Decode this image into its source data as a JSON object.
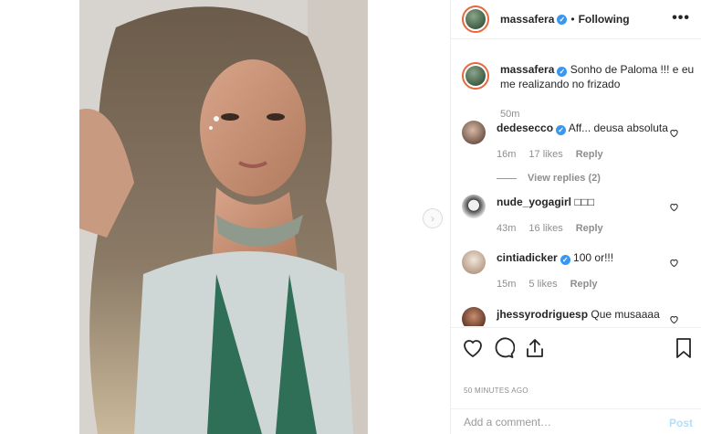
{
  "post": {
    "username": "massafera",
    "follow_status": "Following",
    "dot": "•",
    "verified_mark": "✓",
    "next_arrow": "›",
    "caption": {
      "username": "massafera",
      "text": "Sonho de Paloma !!! e eu me realizando no frizado",
      "time": "50m"
    }
  },
  "comments": [
    {
      "username": "dedesecco",
      "verified": true,
      "text": "Aff... deusa absoluta",
      "time": "16m",
      "likes": "17 likes",
      "reply": "Reply",
      "view_replies": "View replies (2)"
    },
    {
      "username": "nude_yogagirl",
      "verified": false,
      "text": "□□□",
      "time": "43m",
      "likes": "16 likes",
      "reply": "Reply"
    },
    {
      "username": "cintiadicker",
      "verified": true,
      "text": "100 or!!!",
      "time": "15m",
      "likes": "5 likes",
      "reply": "Reply"
    },
    {
      "username": "jhessyrodriguesp",
      "verified": false,
      "text": "Que musaaaa"
    }
  ],
  "timestamp": "50 MINUTES AGO",
  "add_comment": {
    "placeholder": "Add a comment…",
    "post_label": "Post"
  },
  "icons": {
    "like": "heart-icon",
    "comment": "comment-icon",
    "share": "share-icon",
    "save": "bookmark-icon",
    "more": "more-icon"
  },
  "colors": {
    "verified": "#3897f0",
    "muted": "#8e8e8e",
    "post_disabled": "#b2dffc"
  }
}
